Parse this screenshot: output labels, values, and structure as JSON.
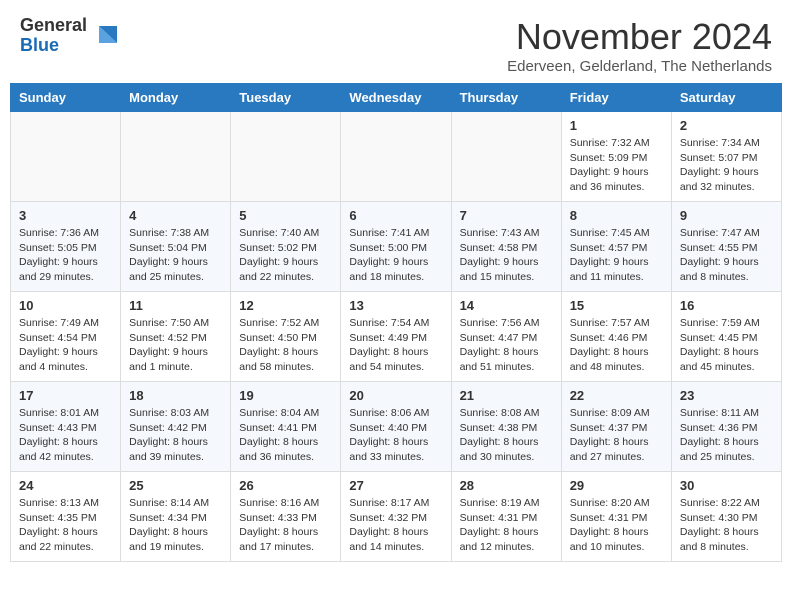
{
  "header": {
    "logo_general": "General",
    "logo_blue": "Blue",
    "month_title": "November 2024",
    "subtitle": "Ederveen, Gelderland, The Netherlands"
  },
  "weekdays": [
    "Sunday",
    "Monday",
    "Tuesday",
    "Wednesday",
    "Thursday",
    "Friday",
    "Saturday"
  ],
  "weeks": [
    [
      {
        "day": "",
        "info": ""
      },
      {
        "day": "",
        "info": ""
      },
      {
        "day": "",
        "info": ""
      },
      {
        "day": "",
        "info": ""
      },
      {
        "day": "",
        "info": ""
      },
      {
        "day": "1",
        "info": "Sunrise: 7:32 AM\nSunset: 5:09 PM\nDaylight: 9 hours and 36 minutes."
      },
      {
        "day": "2",
        "info": "Sunrise: 7:34 AM\nSunset: 5:07 PM\nDaylight: 9 hours and 32 minutes."
      }
    ],
    [
      {
        "day": "3",
        "info": "Sunrise: 7:36 AM\nSunset: 5:05 PM\nDaylight: 9 hours and 29 minutes."
      },
      {
        "day": "4",
        "info": "Sunrise: 7:38 AM\nSunset: 5:04 PM\nDaylight: 9 hours and 25 minutes."
      },
      {
        "day": "5",
        "info": "Sunrise: 7:40 AM\nSunset: 5:02 PM\nDaylight: 9 hours and 22 minutes."
      },
      {
        "day": "6",
        "info": "Sunrise: 7:41 AM\nSunset: 5:00 PM\nDaylight: 9 hours and 18 minutes."
      },
      {
        "day": "7",
        "info": "Sunrise: 7:43 AM\nSunset: 4:58 PM\nDaylight: 9 hours and 15 minutes."
      },
      {
        "day": "8",
        "info": "Sunrise: 7:45 AM\nSunset: 4:57 PM\nDaylight: 9 hours and 11 minutes."
      },
      {
        "day": "9",
        "info": "Sunrise: 7:47 AM\nSunset: 4:55 PM\nDaylight: 9 hours and 8 minutes."
      }
    ],
    [
      {
        "day": "10",
        "info": "Sunrise: 7:49 AM\nSunset: 4:54 PM\nDaylight: 9 hours and 4 minutes."
      },
      {
        "day": "11",
        "info": "Sunrise: 7:50 AM\nSunset: 4:52 PM\nDaylight: 9 hours and 1 minute."
      },
      {
        "day": "12",
        "info": "Sunrise: 7:52 AM\nSunset: 4:50 PM\nDaylight: 8 hours and 58 minutes."
      },
      {
        "day": "13",
        "info": "Sunrise: 7:54 AM\nSunset: 4:49 PM\nDaylight: 8 hours and 54 minutes."
      },
      {
        "day": "14",
        "info": "Sunrise: 7:56 AM\nSunset: 4:47 PM\nDaylight: 8 hours and 51 minutes."
      },
      {
        "day": "15",
        "info": "Sunrise: 7:57 AM\nSunset: 4:46 PM\nDaylight: 8 hours and 48 minutes."
      },
      {
        "day": "16",
        "info": "Sunrise: 7:59 AM\nSunset: 4:45 PM\nDaylight: 8 hours and 45 minutes."
      }
    ],
    [
      {
        "day": "17",
        "info": "Sunrise: 8:01 AM\nSunset: 4:43 PM\nDaylight: 8 hours and 42 minutes."
      },
      {
        "day": "18",
        "info": "Sunrise: 8:03 AM\nSunset: 4:42 PM\nDaylight: 8 hours and 39 minutes."
      },
      {
        "day": "19",
        "info": "Sunrise: 8:04 AM\nSunset: 4:41 PM\nDaylight: 8 hours and 36 minutes."
      },
      {
        "day": "20",
        "info": "Sunrise: 8:06 AM\nSunset: 4:40 PM\nDaylight: 8 hours and 33 minutes."
      },
      {
        "day": "21",
        "info": "Sunrise: 8:08 AM\nSunset: 4:38 PM\nDaylight: 8 hours and 30 minutes."
      },
      {
        "day": "22",
        "info": "Sunrise: 8:09 AM\nSunset: 4:37 PM\nDaylight: 8 hours and 27 minutes."
      },
      {
        "day": "23",
        "info": "Sunrise: 8:11 AM\nSunset: 4:36 PM\nDaylight: 8 hours and 25 minutes."
      }
    ],
    [
      {
        "day": "24",
        "info": "Sunrise: 8:13 AM\nSunset: 4:35 PM\nDaylight: 8 hours and 22 minutes."
      },
      {
        "day": "25",
        "info": "Sunrise: 8:14 AM\nSunset: 4:34 PM\nDaylight: 8 hours and 19 minutes."
      },
      {
        "day": "26",
        "info": "Sunrise: 8:16 AM\nSunset: 4:33 PM\nDaylight: 8 hours and 17 minutes."
      },
      {
        "day": "27",
        "info": "Sunrise: 8:17 AM\nSunset: 4:32 PM\nDaylight: 8 hours and 14 minutes."
      },
      {
        "day": "28",
        "info": "Sunrise: 8:19 AM\nSunset: 4:31 PM\nDaylight: 8 hours and 12 minutes."
      },
      {
        "day": "29",
        "info": "Sunrise: 8:20 AM\nSunset: 4:31 PM\nDaylight: 8 hours and 10 minutes."
      },
      {
        "day": "30",
        "info": "Sunrise: 8:22 AM\nSunset: 4:30 PM\nDaylight: 8 hours and 8 minutes."
      }
    ]
  ]
}
